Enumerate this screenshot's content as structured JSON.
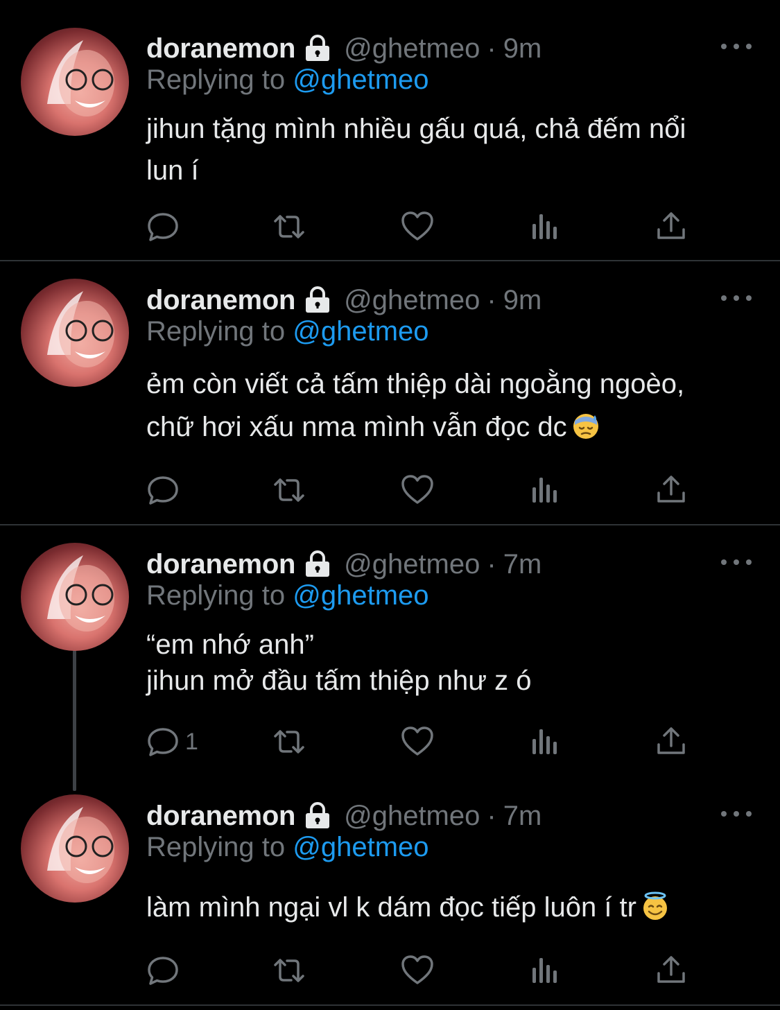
{
  "colors": {
    "background": "#000000",
    "text": "#e7e9ea",
    "muted": "#71767b",
    "accent": "#1d9bf0",
    "divider": "#2f3336"
  },
  "icons": {
    "lock": "lock-icon",
    "more": "more-icon",
    "reply": "reply-icon",
    "retweet": "retweet-icon",
    "like": "heart-icon",
    "views": "views-icon",
    "share": "share-icon"
  },
  "tweets": [
    {
      "name": "doranemon",
      "handle": "@ghetmeo",
      "dot": "·",
      "time": "9m",
      "replying_prefix": "Replying to",
      "replying_to": "@ghetmeo",
      "lines": [
        "jihun tặng mình nhiều gấu quá, chả đếm nổi",
        "lun í"
      ],
      "reply_count": ""
    },
    {
      "name": "doranemon",
      "handle": "@ghetmeo",
      "dot": "·",
      "time": "9m",
      "replying_prefix": "Replying to",
      "replying_to": "@ghetmeo",
      "lines": [
        "ẻm còn viết cả tấm thiệp dài ngoằng ngoèo,",
        "chữ hơi xấu nma mình vẫn đọc dc"
      ],
      "emoji": "downcast-sweat-emoji",
      "reply_count": ""
    },
    {
      "name": "doranemon",
      "handle": "@ghetmeo",
      "dot": "·",
      "time": "7m",
      "replying_prefix": "Replying to",
      "replying_to": "@ghetmeo",
      "lines": [
        "“em nhớ anh”",
        "jihun mở đầu tấm thiệp như z ó"
      ],
      "reply_count": "1"
    },
    {
      "name": "doranemon",
      "handle": "@ghetmeo",
      "dot": "·",
      "time": "7m",
      "replying_prefix": "Replying to",
      "replying_to": "@ghetmeo",
      "lines": [
        "làm mình ngại vl k dám đọc tiếp luôn í tr"
      ],
      "emoji": "halo-smile-emoji",
      "reply_count": ""
    }
  ]
}
